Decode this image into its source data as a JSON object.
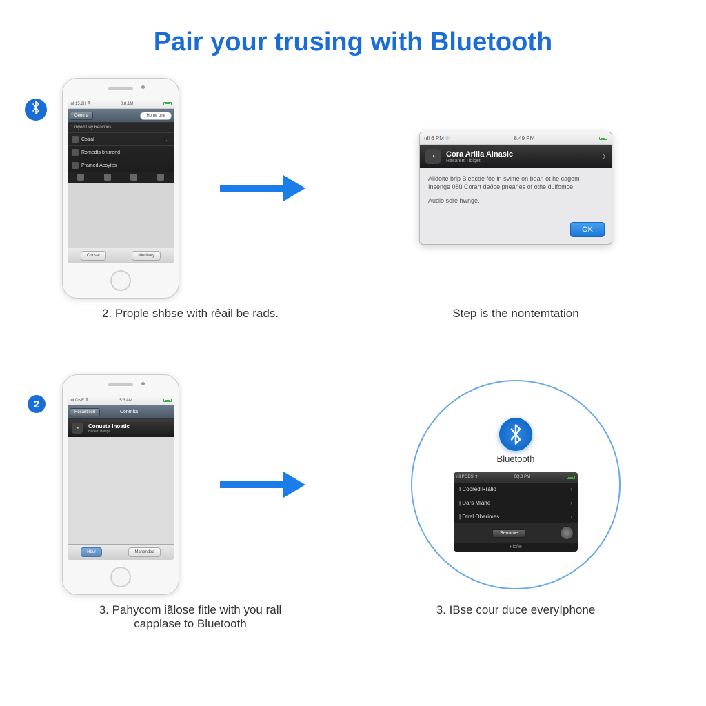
{
  "title": "Pair your trusing with Bluetooth",
  "colors": {
    "accent": "#1a6dd6"
  },
  "q1": {
    "badge_icon": "bluetooth",
    "phone": {
      "status": {
        "left": "0.8.1M",
        "carrier": "ıııl  15.8H"
      },
      "nav": {
        "back": "Genera",
        "pill": "Home one"
      },
      "panel_title": "1 myed Day Reovities",
      "items": [
        "Cotral",
        "Romedts bntrrend",
        "Pramed Acoytes"
      ],
      "toolbar": [
        "Consel",
        "Nieritiary"
      ]
    },
    "caption": "2. Prople shbse with rêail be rads."
  },
  "q2": {
    "dialog": {
      "status": {
        "left": "ııll 6 PM",
        "time": "8.49 PM"
      },
      "header_title": "Cora Arllia Alnasic",
      "header_sub": "Rasarert Tldiget",
      "body1": "Alldoite brip Bleacde fôe in svime on boan ot he cagem Insenge 08ü Corart deðce pneařies of othe dulfomce.",
      "body2": "Audio soře hwnge.",
      "ok": "OK"
    },
    "caption": "Step is the nontemtation"
  },
  "q3": {
    "badge": "2",
    "phone": {
      "status": {
        "left": "ıııl ONE",
        "time": "5:3 AM"
      },
      "nav": {
        "back": "Resantiocrl",
        "title": "Conmita"
      },
      "header_title": "Conueta Inoatic",
      "header_sub": "Hsoed Ttaiitge",
      "toolbar": [
        "Hbur",
        "Manendea"
      ]
    },
    "caption": "3. Pahycom iãlose fitle with you rall capplase to Bluetooth"
  },
  "q4": {
    "bt_label": "Bluetooth",
    "device": {
      "status": {
        "left": "ııll POĐS",
        "time": "0Q.3 PM"
      },
      "items": [
        "I Copred Rralio",
        "| Dars Mlahe",
        "| Dtrel Oberimes"
      ],
      "action": "Senume",
      "sub": "Floñe"
    },
    "caption": "3. IBse cour duce everyIphone"
  }
}
